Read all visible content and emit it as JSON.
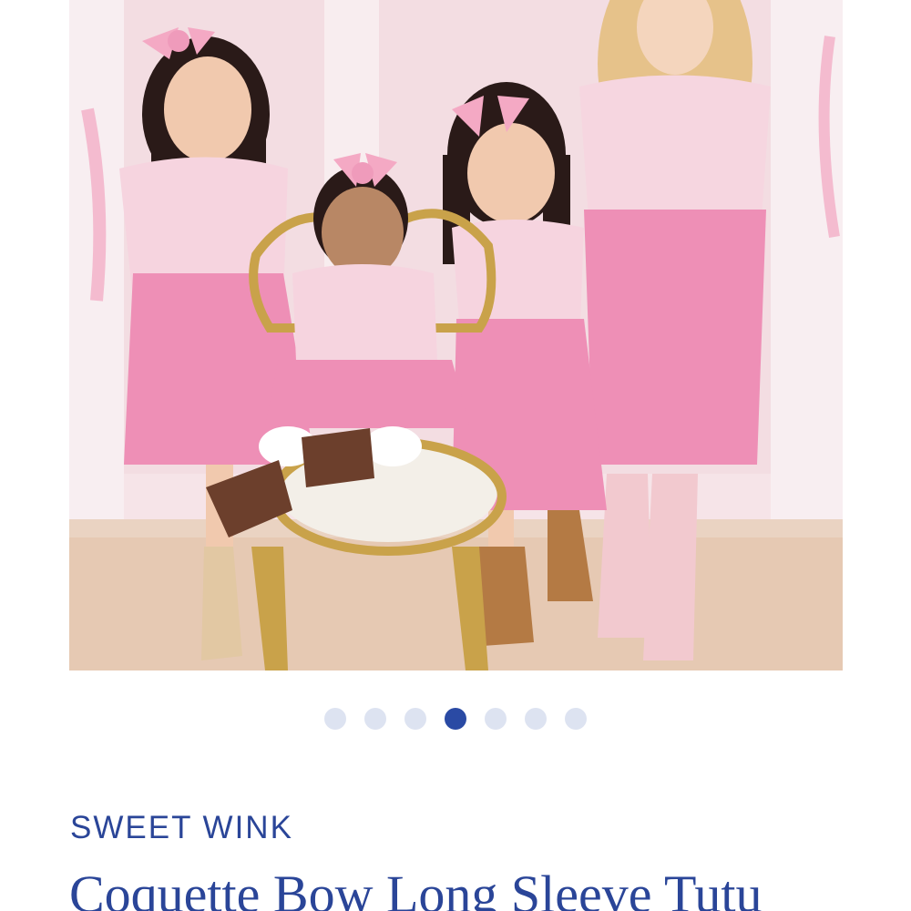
{
  "product": {
    "brand": "SWEET WINK",
    "title": "Coquette Bow Long Sleeve Tutu",
    "image_alt": "Four girls in matching pink coquette bow long sleeve tutu dresses around a gold chair"
  },
  "carousel": {
    "total": 7,
    "active_index": 3,
    "colors": {
      "active": "#2a4aa4",
      "inactive": "#dde3f1"
    }
  },
  "colors": {
    "brand_text": "#2a4598",
    "dress_pink": "#ee8fb6",
    "backdrop": "#f4dde3"
  }
}
